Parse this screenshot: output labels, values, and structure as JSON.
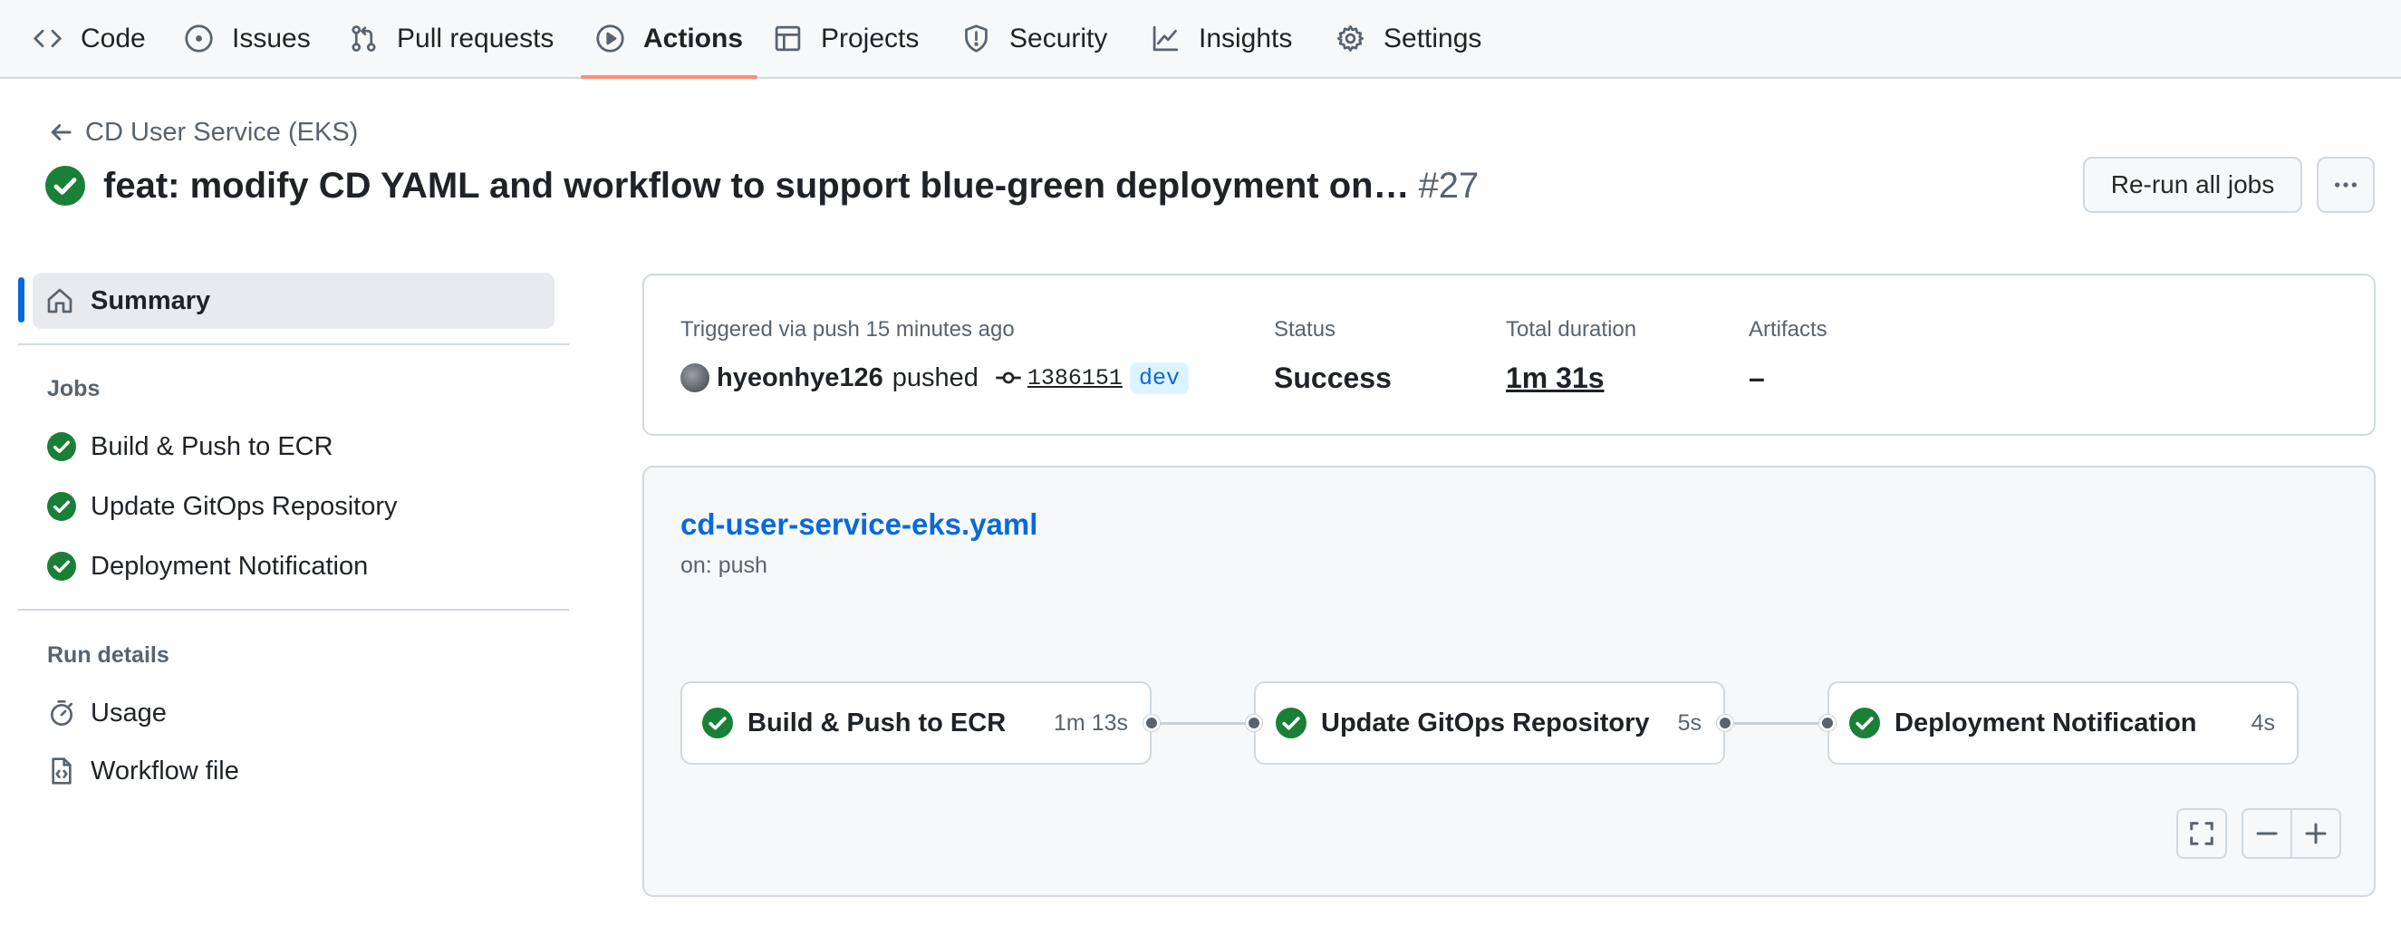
{
  "nav": {
    "tabs": [
      {
        "label": "Code",
        "icon": "code-icon"
      },
      {
        "label": "Issues",
        "icon": "issue-opened-icon"
      },
      {
        "label": "Pull requests",
        "icon": "git-pull-request-icon"
      },
      {
        "label": "Actions",
        "icon": "play-icon",
        "active": true
      },
      {
        "label": "Projects",
        "icon": "table-icon"
      },
      {
        "label": "Security",
        "icon": "shield-icon"
      },
      {
        "label": "Insights",
        "icon": "graph-icon"
      },
      {
        "label": "Settings",
        "icon": "gear-icon"
      }
    ]
  },
  "header": {
    "back_label": "CD User Service (EKS)",
    "title": "feat: modify CD YAML and workflow to support blue-green deployment on…",
    "run_number": "#27",
    "rerun_label": "Re-run all jobs"
  },
  "sidebar": {
    "summary_label": "Summary",
    "jobs_heading": "Jobs",
    "jobs": [
      {
        "label": "Build & Push to ECR",
        "status": "success"
      },
      {
        "label": "Update GitOps Repository",
        "status": "success"
      },
      {
        "label": "Deployment Notification",
        "status": "success"
      }
    ],
    "run_details_heading": "Run details",
    "run_details": [
      {
        "label": "Usage",
        "icon": "stopwatch-icon"
      },
      {
        "label": "Workflow file",
        "icon": "file-code-icon"
      }
    ]
  },
  "summary": {
    "trigger_label": "Triggered via push 15 minutes ago",
    "actor": "hyeonhye126",
    "action": "pushed",
    "commit_sha": "1386151",
    "branch": "dev",
    "status_label": "Status",
    "status_value": "Success",
    "duration_label": "Total duration",
    "duration_value": "1m 31s",
    "artifacts_label": "Artifacts",
    "artifacts_value": "–"
  },
  "workflow": {
    "file_name": "cd-user-service-eks.yaml",
    "trigger": "on: push",
    "jobs": [
      {
        "name": "Build & Push to ECR",
        "duration": "1m 13s",
        "status": "success"
      },
      {
        "name": "Update GitOps Repository",
        "duration": "5s",
        "status": "success"
      },
      {
        "name": "Deployment Notification",
        "duration": "4s",
        "status": "success"
      }
    ]
  },
  "colors": {
    "success": "#1a7f37",
    "link": "#0969da",
    "active_tab_underline": "#fd8c73"
  }
}
